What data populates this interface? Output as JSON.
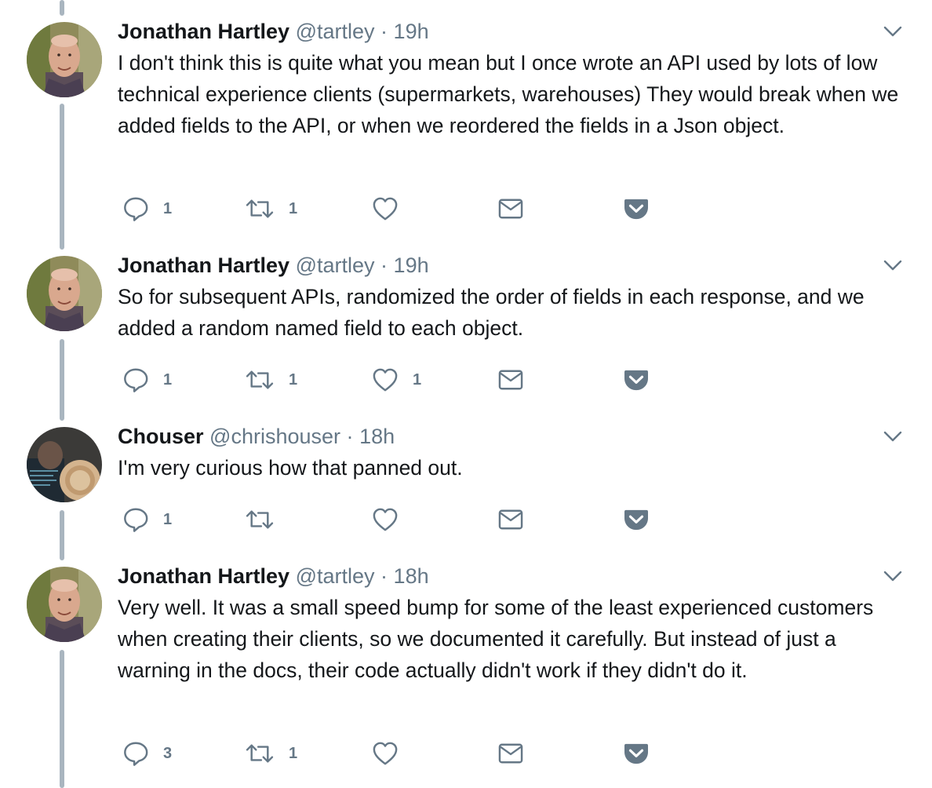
{
  "colors": {
    "text": "#14171a",
    "secondary": "#657786",
    "thread_line": "#a9b5bf",
    "icon": "#657786"
  },
  "icons": {
    "reply": "reply-icon",
    "retweet": "retweet-icon",
    "like": "heart-icon",
    "dm": "envelope-icon",
    "pocket": "pocket-icon",
    "menu": "chevron-down-icon"
  },
  "tweets": [
    {
      "name": "Jonathan Hartley",
      "handle": "@tartley",
      "sep": "·",
      "time": "19h",
      "text": "I don't think this is quite what you mean but I once wrote an API used by lots of low technical experience clients (supermarkets, warehouses) They would break when we added fields to the API, or when we reordered the fields in a Json object.",
      "replies": "1",
      "retweets": "1",
      "likes": ""
    },
    {
      "name": "Jonathan Hartley",
      "handle": "@tartley",
      "sep": "·",
      "time": "19h",
      "text": "So for subsequent APIs, randomized the order of fields in each response, and we added a random named field to each object.",
      "replies": "1",
      "retweets": "1",
      "likes": "1"
    },
    {
      "name": "Chouser",
      "handle": "@chrishouser",
      "sep": "·",
      "time": "18h",
      "text": "I'm very curious how that panned out.",
      "replies": "1",
      "retweets": "",
      "likes": ""
    },
    {
      "name": "Jonathan Hartley",
      "handle": "@tartley",
      "sep": "·",
      "time": "18h",
      "text": "Very well. It was a small speed bump for some of the least experienced customers when creating their clients, so we documented it carefully. But instead of just a warning in the docs, their code actually didn't work if they didn't do it.",
      "replies": "3",
      "retweets": "1",
      "likes": ""
    }
  ]
}
